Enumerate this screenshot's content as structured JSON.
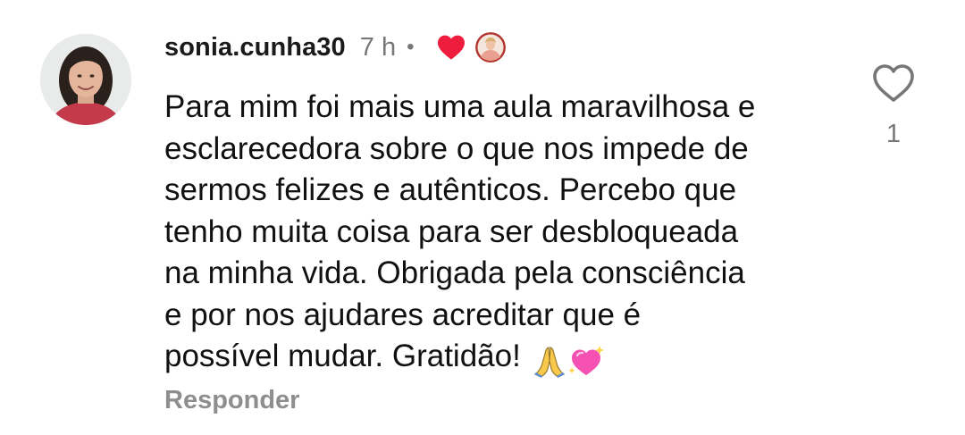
{
  "comment": {
    "username": "sonia.cunha30",
    "time": "7 h",
    "separator": "•",
    "liked_by_creator": true,
    "text_lines": [
      "Para mim foi mais uma aula maravilhosa e",
      "esclarecedora sobre o que nos impede de",
      "sermos felizes e autênticos. Percebo que",
      "tenho muita coisa para ser desbloqueada",
      "na minha vida. Obrigada pela consciência",
      "e por nos ajudares acreditar que é",
      "possível mudar. Gratidão!"
    ],
    "emojis": [
      "folded-hands",
      "sparkling-heart"
    ],
    "reply_label": "Responder",
    "like_count": "1"
  },
  "icons": {
    "like": "heart-outline-icon",
    "creator_like": "red-heart-icon"
  },
  "colors": {
    "text": "#111111",
    "muted": "#8e8e8e",
    "heart_red": "#ee1d3d"
  }
}
